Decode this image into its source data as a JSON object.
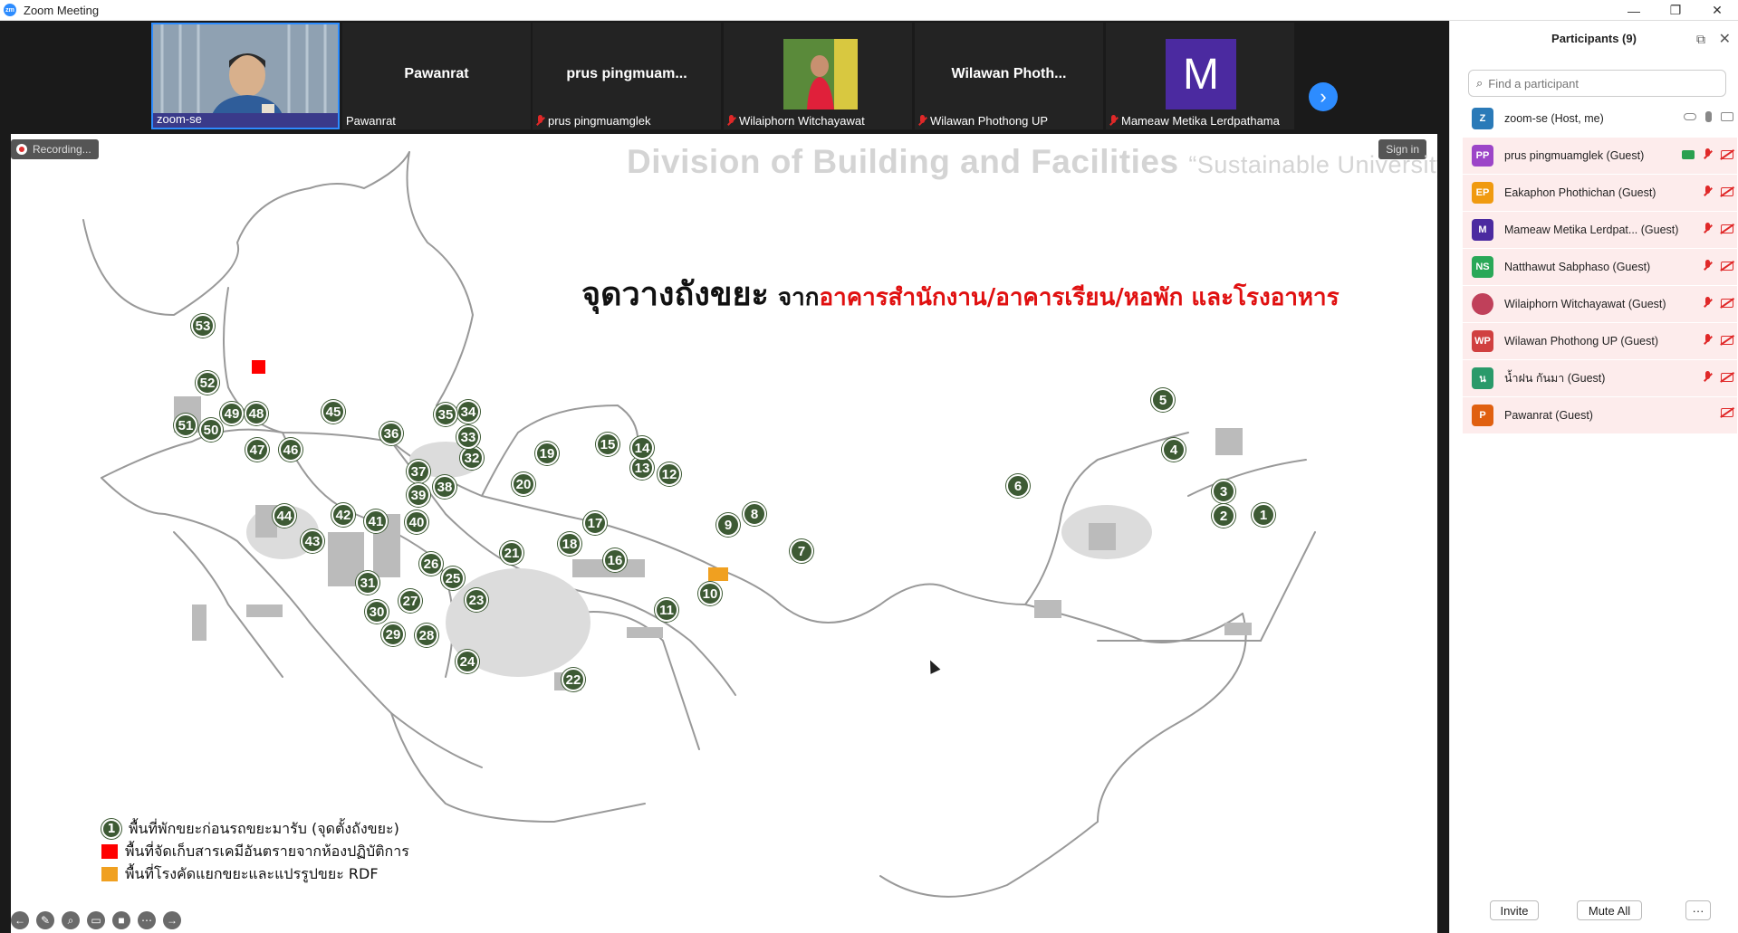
{
  "window": {
    "title": "Zoom Meeting",
    "logo_text": "zm"
  },
  "strip": {
    "tiles": [
      {
        "display": "",
        "label": "zoom-se",
        "muted": false
      },
      {
        "display": "Pawanrat",
        "label": "Pawanrat",
        "muted": false
      },
      {
        "display": "prus  pingmuam...",
        "label": "prus pingmuamglek",
        "muted": true
      },
      {
        "display": "",
        "label": "Wilaiphorn Witchayawat",
        "muted": true
      },
      {
        "display": "Wilawan  Photh...",
        "label": "Wilawan Phothong UP",
        "muted": true
      },
      {
        "display": "M",
        "label": "Mameaw Metika Lerdpathama",
        "muted": true
      }
    ],
    "avatar_m_color": "#4b2aa0"
  },
  "share": {
    "recording_label": "Recording...",
    "signin_label": "Sign in",
    "division_title": "Division of Building and Facilities",
    "division_quote": "“Sustainable University",
    "heading_main": "จุดวางถังขยะ",
    "heading_from": "จาก",
    "heading_red": "อาคารสำนักงาน/อาคารเรียน/หอพัก และโรงอาหาร",
    "markers": [
      "1",
      "2",
      "3",
      "4",
      "5",
      "6",
      "7",
      "8",
      "9",
      "10",
      "11",
      "12",
      "13",
      "14",
      "15",
      "16",
      "17",
      "18",
      "19",
      "20",
      "21",
      "22",
      "23",
      "24",
      "25",
      "26",
      "27",
      "28",
      "29",
      "30",
      "31",
      "32",
      "33",
      "34",
      "35",
      "36",
      "37",
      "38",
      "39",
      "40",
      "41",
      "42",
      "43",
      "44",
      "45",
      "46",
      "47",
      "48",
      "49",
      "50",
      "51",
      "52",
      "53"
    ],
    "legend": {
      "marker_text": "1",
      "item1": "พื้นที่พักขยะก่อนรถขยะมารับ (จุดตั้งถังขยะ)",
      "item2": "พื้นที่จัดเก็บสารเคมีอันตรายจากห้องปฏิบัติการ",
      "item3": "พื้นที่โรงคัดแยกขยะและแปรรูปขยะ RDF"
    },
    "colors": {
      "marker": "#3d5a34",
      "hazard": "#ff0000",
      "rdf": "#f0a020",
      "heading_red": "#e01010"
    }
  },
  "panel": {
    "title": "Participants (9)",
    "search_placeholder": "Find a participant",
    "participants": [
      {
        "initials": "Z",
        "name": "zoom-se (Host, me)",
        "color": "#2a7ab8"
      },
      {
        "initials": "PP",
        "name": "prus pingmuamglek (Guest)",
        "color": "#9c45c8"
      },
      {
        "initials": "EP",
        "name": "Eakaphon Phothichan (Guest)",
        "color": "#f09a10"
      },
      {
        "initials": "M",
        "name": "Mameaw Metika Lerdpat... (Guest)",
        "color": "#4b2aa0"
      },
      {
        "initials": "NS",
        "name": "Natthawut Sabphaso (Guest)",
        "color": "#2aa858"
      },
      {
        "initials": "",
        "name": "Wilaiphorn Witchayawat (Guest)",
        "color": "#c0405a"
      },
      {
        "initials": "WP",
        "name": "Wilawan Phothong UP (Guest)",
        "color": "#d04040"
      },
      {
        "initials": "น",
        "name": "น้ำฝน กันมา (Guest)",
        "color": "#2a9a6a"
      },
      {
        "initials": "P",
        "name": "Pawanrat (Guest)",
        "color": "#e06010"
      }
    ],
    "invite_label": "Invite",
    "muteall_label": "Mute All",
    "more_label": "···"
  }
}
